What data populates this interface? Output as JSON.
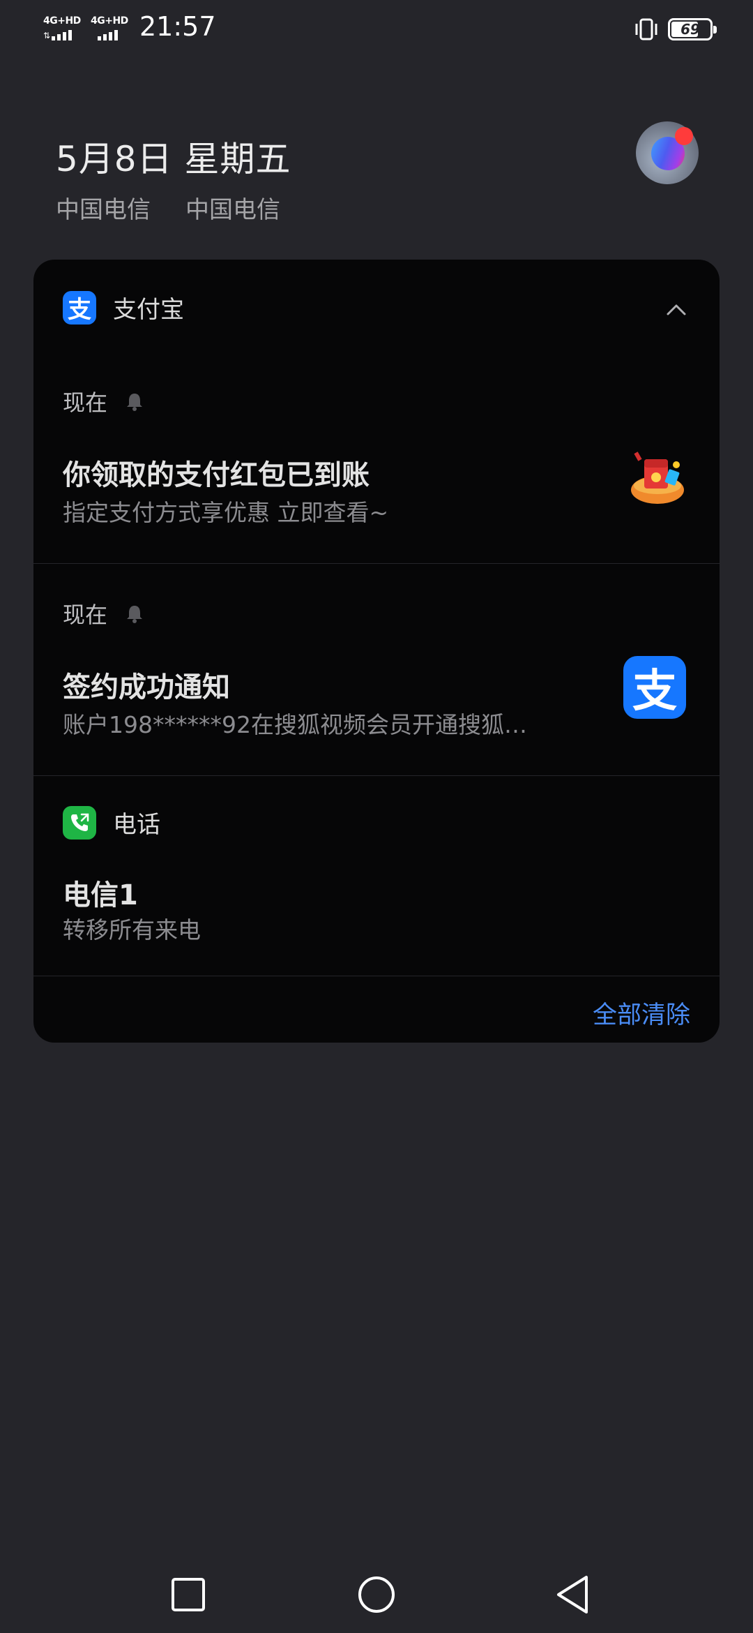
{
  "status_bar": {
    "sim1_label": "4G+HD",
    "sim2_label": "4G+HD",
    "time": "21:57",
    "battery_level": "69",
    "vibrate_icon": "vibrate-icon",
    "battery_icon": "battery-icon"
  },
  "header": {
    "date": "5月8日  星期五",
    "carrier1": "中国电信",
    "carrier2": "中国电信",
    "assistant_icon": "breeno-assistant-icon"
  },
  "notifications": {
    "group1": {
      "app_name": "支付宝",
      "app_icon_glyph": "支",
      "items": [
        {
          "time": "现在",
          "title": "你领取的支付红包已到账",
          "body": "指定支付方式享优惠    立即查看~"
        },
        {
          "time": "现在",
          "title": "签约成功通知",
          "body": "账户198******92在搜狐视频会员开通搜狐…",
          "thumb_glyph": "支"
        }
      ]
    },
    "group2": {
      "app_name": "电话",
      "title": "电信1",
      "body": "转移所有来电"
    },
    "clear_all": "全部清除"
  },
  "colors": {
    "background": "#25252a",
    "card": "#060607",
    "alipay_blue": "#1677ff",
    "phone_green": "#1fb545",
    "link_blue": "#4a8cf5"
  }
}
